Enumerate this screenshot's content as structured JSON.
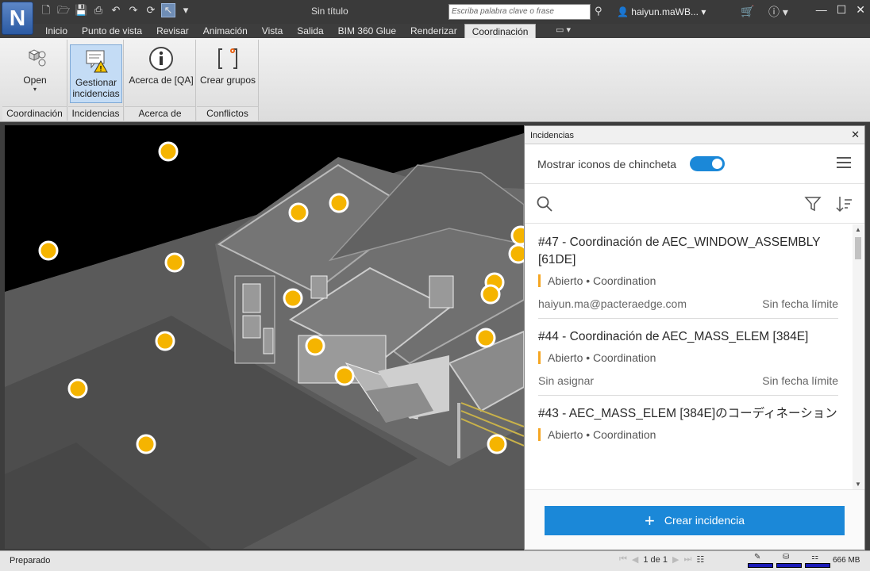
{
  "titlebar": {
    "logo": "N",
    "title": "Sin título",
    "search_placeholder": "Escriba palabra clave o frase",
    "user": "haiyun.maWB...",
    "help": "?"
  },
  "tabs": [
    "Inicio",
    "Punto de vista",
    "Revisar",
    "Animación",
    "Vista",
    "Salida",
    "BIM 360 Glue",
    "Renderizar",
    "Coordinación"
  ],
  "active_tab": "Coordinación",
  "ribbon": {
    "open": {
      "label": "Open",
      "group": "Coordinación"
    },
    "manage": {
      "label1": "Gestionar",
      "label2": "incidencias",
      "group": "Incidencias"
    },
    "about": {
      "label": "Acerca de [QA]",
      "group": "Acerca de"
    },
    "groups": {
      "label": "Crear grupos",
      "group": "Conflictos"
    }
  },
  "panel": {
    "title": "Incidencias",
    "toggle_label": "Mostrar iconos de chincheta",
    "toggle_on": true,
    "create_button": "Crear incidencia",
    "accent_color": "#1b88d8",
    "status_color": "#f5a623"
  },
  "issues": [
    {
      "title": "#47 - Coordinación de AEC_WINDOW_ASSEMBLY [61DE]",
      "status": "Abierto • Coordination",
      "assignee": "haiyun.ma@pacteraedge.com",
      "due": "Sin fecha límite"
    },
    {
      "title": "#44 - Coordinación de AEC_MASS_ELEM [384E]",
      "status": "Abierto • Coordination",
      "assignee": "Sin asignar",
      "due": "Sin fecha límite"
    },
    {
      "title": "#43 - AEC_MASS_ELEM [384E]のコーディネーション",
      "status": "Abierto • Coordination",
      "assignee": "",
      "due": ""
    }
  ],
  "statusbar": {
    "status": "Preparado",
    "page": "1 de 1",
    "memory": "666 MB"
  }
}
